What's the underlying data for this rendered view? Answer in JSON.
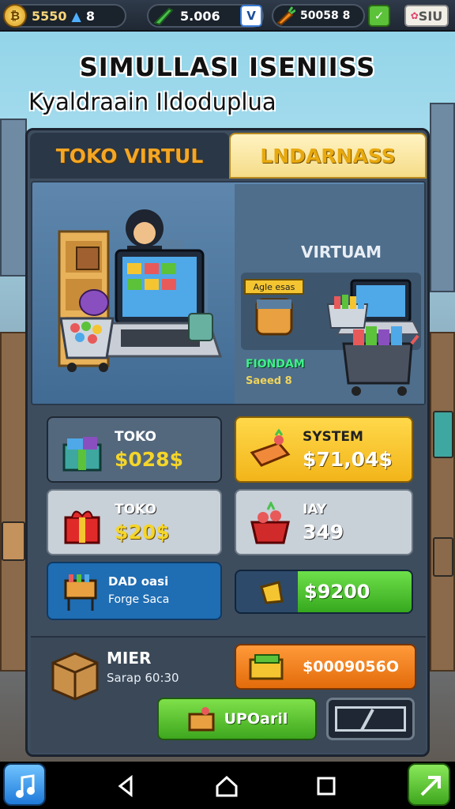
{
  "hud": {
    "coins": "5550",
    "coin_icon_glyph": "₿",
    "btn1": "8",
    "gems": "5.006",
    "check1": "V",
    "carrot_value": "50058 8",
    "icon_label": "SIU"
  },
  "title": "SIMULLASI ISENIISS",
  "subtitle": "Kyaldraain Ildoduplua",
  "tabs": {
    "left": "TOKO VIRTUL",
    "right": "LNDARNASS"
  },
  "scene": {
    "title": "VIRTUAM",
    "tag": "Agle esas",
    "label1": "FIONDAM",
    "label2": "Saeed 8"
  },
  "cards": [
    {
      "label": "TOKO",
      "value": "$028$"
    },
    {
      "label": "SYSTEM",
      "value": "$71,04$"
    },
    {
      "label": "TOKO",
      "value": "$20$"
    },
    {
      "label": "IAY",
      "value": "349"
    },
    {
      "label": "DAD oasi",
      "value": "Forge Saca"
    },
    {
      "label": "",
      "value": "$9200"
    }
  ],
  "bottom": {
    "item_label": "MIER",
    "item_sub": "Sarap 60:30",
    "orange_value": "$0009056O",
    "upgrade": "UPOaril"
  },
  "colors": {
    "accent": "#f5a623",
    "green": "#3ea71e",
    "orange": "#e36b0a"
  }
}
